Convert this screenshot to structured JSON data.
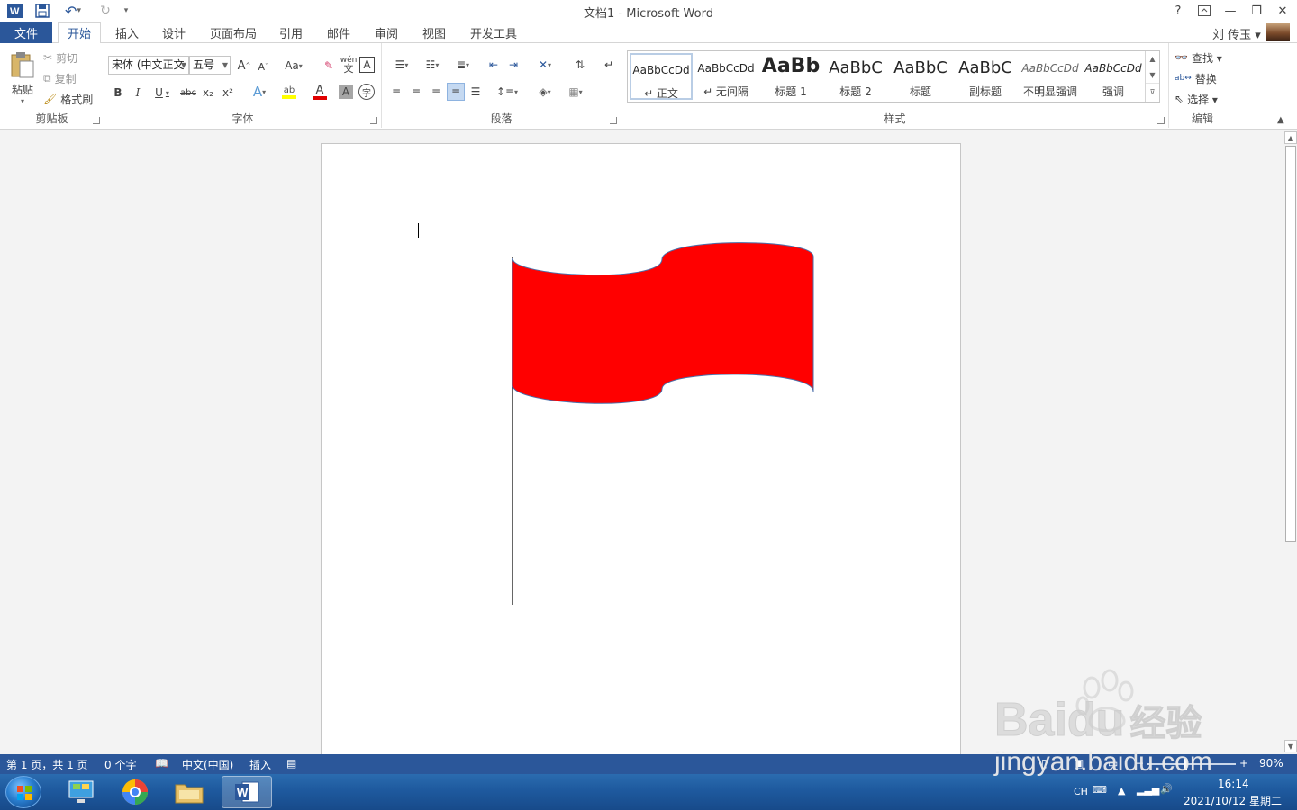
{
  "window": {
    "title": "文档1 - Microsoft Word",
    "help": "?",
    "restore_ribbon": "⌂",
    "minimize": "—",
    "maximize": "❐",
    "close": "✕"
  },
  "quick_access": {
    "undo_arrow": "▾",
    "customize": "▾"
  },
  "tabs": {
    "file": "文件",
    "items": [
      "开始",
      "插入",
      "设计",
      "页面布局",
      "引用",
      "邮件",
      "审阅",
      "视图",
      "开发工具"
    ],
    "active": "开始"
  },
  "user": {
    "name": "刘 传玉 ▾"
  },
  "ribbon": {
    "clipboard": {
      "label": "剪贴板",
      "paste": "粘贴",
      "cut": "剪切",
      "copy": "复制",
      "format_painter": "格式刷"
    },
    "font": {
      "label": "字体",
      "font_name": "宋体 (中文正文",
      "font_size": "五号",
      "grow": "A",
      "shrink": "A",
      "change_case": "Aa",
      "bold": "B",
      "italic": "I",
      "underline": "U",
      "strikethrough": "abc",
      "subscript": "x₂",
      "superscript": "x²",
      "font_color_letter": "A",
      "char_shading": "A",
      "enclose": "字",
      "pinyin": "wén",
      "border_char": "A"
    },
    "paragraph": {
      "label": "段落"
    },
    "styles": {
      "label": "样式",
      "items": [
        {
          "sample": "AaBbCcDd",
          "name": "↵ 正文"
        },
        {
          "sample": "AaBbCcDd",
          "name": "↵ 无间隔"
        },
        {
          "sample": "AaBb",
          "name": "标题 1"
        },
        {
          "sample": "AaBbC",
          "name": "标题 2"
        },
        {
          "sample": "AaBbC",
          "name": "标题"
        },
        {
          "sample": "AaBbC",
          "name": "副标题"
        },
        {
          "sample": "AaBbCcDd",
          "name": "不明显强调"
        },
        {
          "sample": "AaBbCcDd",
          "name": "强调"
        }
      ]
    },
    "editing": {
      "label": "编辑",
      "find": "查找 ▾",
      "replace": "替换",
      "select": "选择 ▾"
    }
  },
  "document": {
    "flag_color": "#ff0000",
    "flag_outline": "#4a6ea9"
  },
  "statusbar": {
    "page": "第 1 页，共 1 页",
    "words": "0 个字",
    "language": "中文(中国)",
    "mode": "插入",
    "zoom": "90%",
    "zoom_minus": "−",
    "zoom_plus": "+"
  },
  "taskbar": {
    "ime": "CH",
    "time": "16:14",
    "date": "2021/10/12 星期二"
  },
  "watermark": {
    "brand": "Baidu",
    "brand_cn": "经验",
    "url": "jingyan.baidu.com"
  }
}
